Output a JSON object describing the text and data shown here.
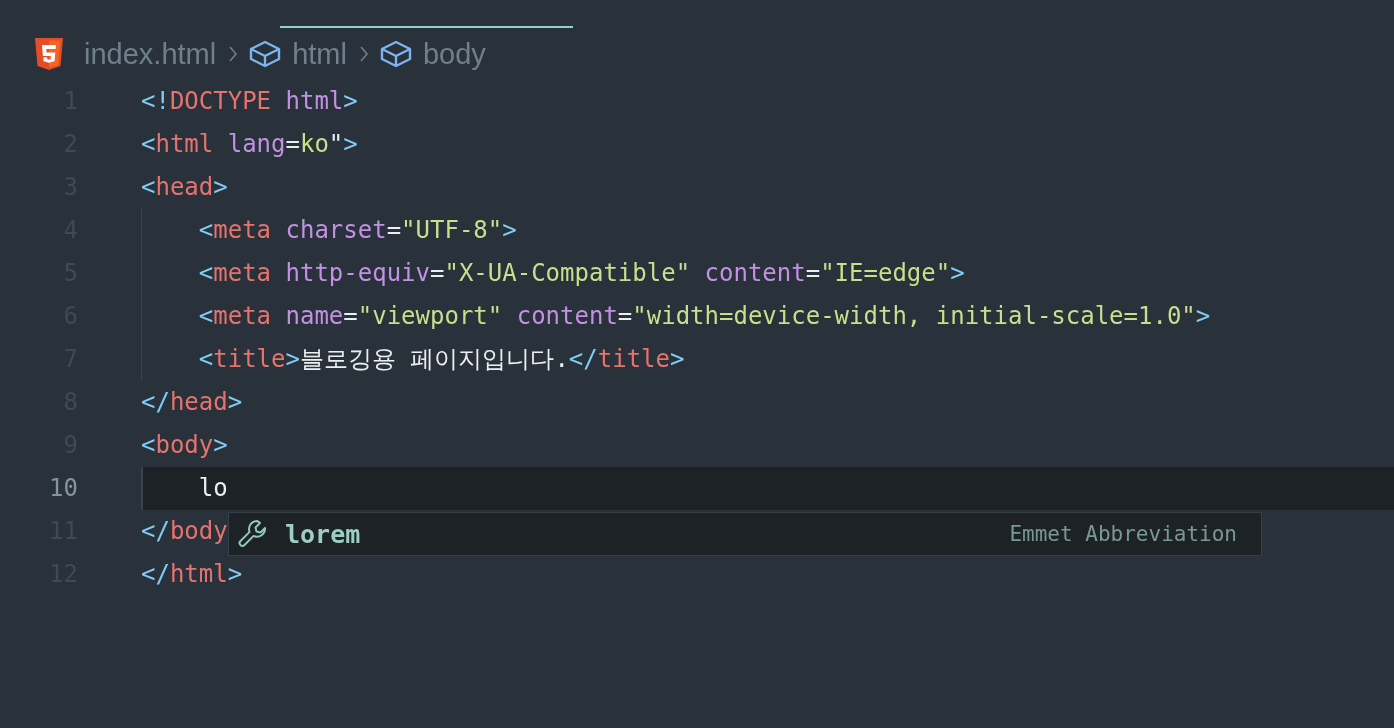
{
  "breadcrumbs": [
    {
      "kind": "file",
      "label": "index.html"
    },
    {
      "kind": "element",
      "label": "html"
    },
    {
      "kind": "element",
      "label": "body"
    }
  ],
  "lines": [
    {
      "number": "1",
      "current": false,
      "tokens": [
        {
          "kind": "punct",
          "text": "<!"
        },
        {
          "kind": "tag",
          "text": "DOCTYPE"
        },
        {
          "kind": "attr",
          "text": " html"
        },
        {
          "kind": "punct",
          "text": ">"
        }
      ]
    },
    {
      "number": "2",
      "current": false,
      "tokens": [
        {
          "kind": "punct",
          "text": "<"
        },
        {
          "kind": "tag",
          "text": "html"
        },
        {
          "kind": "attr",
          "text": " lang"
        },
        {
          "kind": "text",
          "text": "="
        },
        {
          "kind": "string",
          "text": "ko"
        },
        {
          "kind": "text",
          "text": "\""
        },
        {
          "kind": "punct",
          "text": ">"
        }
      ]
    },
    {
      "number": "3",
      "current": false,
      "tokens": [
        {
          "kind": "punct",
          "text": "<"
        },
        {
          "kind": "tag",
          "text": "head"
        },
        {
          "kind": "punct",
          "text": ">"
        }
      ]
    },
    {
      "number": "4",
      "current": false,
      "tokens": [
        {
          "kind": "punct",
          "text": "    <"
        },
        {
          "kind": "tag",
          "text": "meta"
        },
        {
          "kind": "attr",
          "text": " charset"
        },
        {
          "kind": "text",
          "text": "="
        },
        {
          "kind": "string",
          "text": "\"UTF-8\""
        },
        {
          "kind": "punct",
          "text": ">"
        }
      ]
    },
    {
      "number": "5",
      "current": false,
      "tokens": [
        {
          "kind": "punct",
          "text": "    <"
        },
        {
          "kind": "tag",
          "text": "meta"
        },
        {
          "kind": "attr",
          "text": " http-equiv"
        },
        {
          "kind": "text",
          "text": "="
        },
        {
          "kind": "string",
          "text": "\"X-UA-Compatible\""
        },
        {
          "kind": "attr",
          "text": " content"
        },
        {
          "kind": "text",
          "text": "="
        },
        {
          "kind": "string",
          "text": "\"IE=edge\""
        },
        {
          "kind": "punct",
          "text": ">"
        }
      ]
    },
    {
      "number": "6",
      "current": false,
      "tokens": [
        {
          "kind": "punct",
          "text": "    <"
        },
        {
          "kind": "tag",
          "text": "meta"
        },
        {
          "kind": "attr",
          "text": " name"
        },
        {
          "kind": "text",
          "text": "="
        },
        {
          "kind": "string",
          "text": "\"viewport\""
        },
        {
          "kind": "attr",
          "text": " content"
        },
        {
          "kind": "text",
          "text": "="
        },
        {
          "kind": "string",
          "text": "\"width=device-width, initial-scale=1.0\""
        },
        {
          "kind": "punct",
          "text": ">"
        }
      ]
    },
    {
      "number": "7",
      "current": false,
      "tokens": [
        {
          "kind": "punct",
          "text": "    <"
        },
        {
          "kind": "tag",
          "text": "title"
        },
        {
          "kind": "punct",
          "text": ">"
        },
        {
          "kind": "text",
          "text": "블로깅용 페이지입니다."
        },
        {
          "kind": "punct",
          "text": "</"
        },
        {
          "kind": "tag",
          "text": "title"
        },
        {
          "kind": "punct",
          "text": ">"
        }
      ]
    },
    {
      "number": "8",
      "current": false,
      "tokens": [
        {
          "kind": "punct",
          "text": "</"
        },
        {
          "kind": "tag",
          "text": "head"
        },
        {
          "kind": "punct",
          "text": ">"
        }
      ]
    },
    {
      "number": "9",
      "current": false,
      "tokens": [
        {
          "kind": "punct",
          "text": "<"
        },
        {
          "kind": "tag",
          "text": "body"
        },
        {
          "kind": "punct",
          "text": ">"
        }
      ]
    },
    {
      "number": "10",
      "current": true,
      "tokens": [
        {
          "kind": "text",
          "text": "    lo"
        }
      ]
    },
    {
      "number": "11",
      "current": false,
      "tokens": [
        {
          "kind": "punct",
          "text": "</"
        },
        {
          "kind": "tag",
          "text": "body"
        }
      ]
    },
    {
      "number": "12",
      "current": false,
      "tokens": [
        {
          "kind": "punct",
          "text": "</"
        },
        {
          "kind": "tag",
          "text": "html"
        },
        {
          "kind": "punct",
          "text": ">"
        }
      ]
    }
  ],
  "suggestion": {
    "label": "lorem",
    "detail": "Emmet Abbreviation",
    "selected": true
  }
}
